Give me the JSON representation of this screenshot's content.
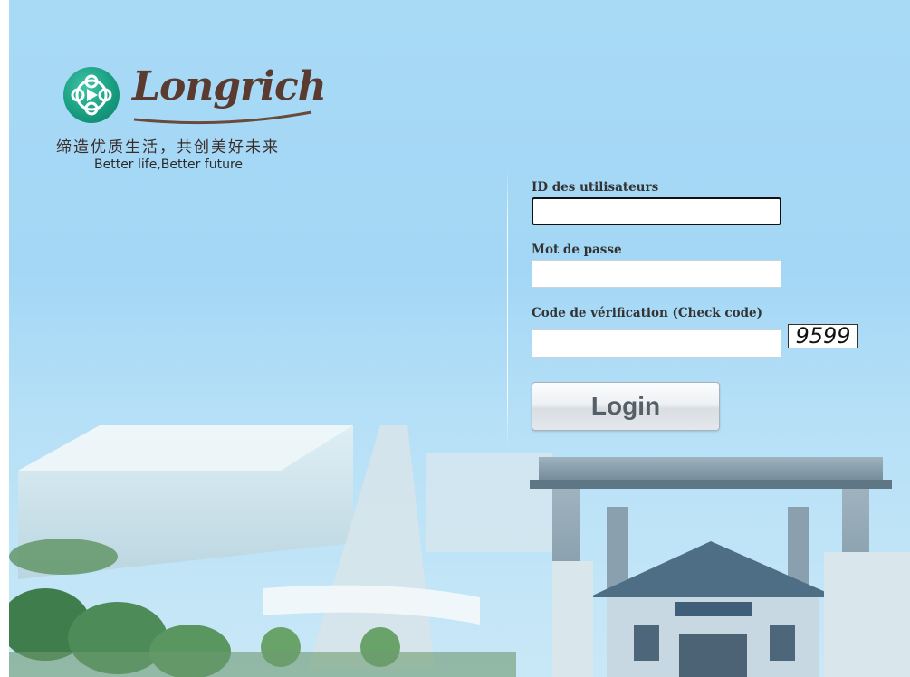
{
  "branding": {
    "brand_name": "Longrich",
    "slogan_cn": "缔造优质生活，共创美好未来",
    "slogan_en": "Better life,Better future"
  },
  "form": {
    "user_id": {
      "label": "ID des utilisateurs",
      "value": ""
    },
    "password": {
      "label": "Mot de passe",
      "value": ""
    },
    "check_code": {
      "label": "Code de vérification (Check code)",
      "value": "",
      "captcha": "9599"
    },
    "login_label": "Login"
  },
  "colors": {
    "background": "#a8daf6",
    "logo_green": "#169a7d",
    "brand_brown": "#5b3a30"
  }
}
